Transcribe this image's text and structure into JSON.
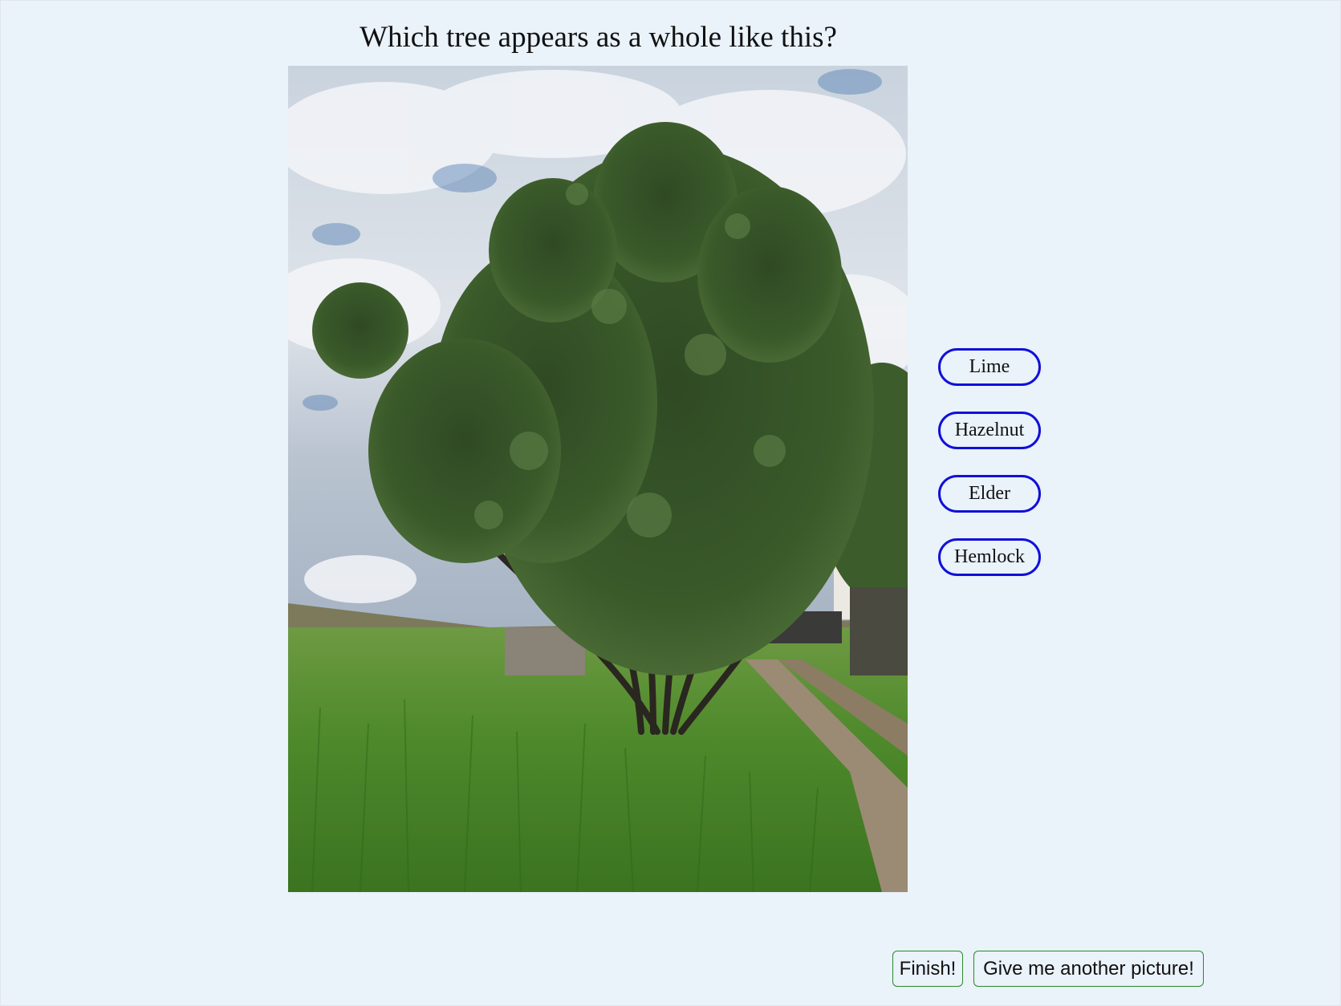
{
  "quiz": {
    "question": "Which tree appears as a whole like this?",
    "image_description_icon": "tree-photo",
    "answers": [
      {
        "label": "Lime"
      },
      {
        "label": "Hazelnut"
      },
      {
        "label": "Elder"
      },
      {
        "label": "Hemlock"
      }
    ],
    "accent_color": "#1010d8",
    "background_color": "#eaf2fa"
  },
  "actions": {
    "finish_label": "Finish!",
    "another_label": "Give me another picture!",
    "border_color": "#2a8a2a"
  }
}
